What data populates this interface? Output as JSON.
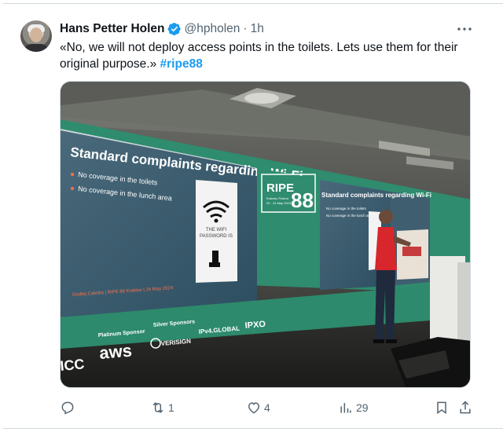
{
  "tweet": {
    "author_name": "Hans Petter Holen",
    "handle": "@hpholen",
    "separator": "·",
    "time": "1h",
    "text_main": "«No, we will not deploy access points in the toilets. Lets use them for their original purpose.» ",
    "hashtag": "#ripe88"
  },
  "media": {
    "slide_title": "Standard complaints regarding Wi-Fi",
    "bullet_1": "No coverage in the toilets",
    "bullet_2": "No coverage in the lunch area",
    "sign_text_1": "THE WIFI",
    "sign_text_2": "PASSWORD IS",
    "slide_footer": "Ondřej Caletka | RIPE 88 Kraków | 24 May 2024",
    "event_logo": "RIPE",
    "event_number": "88",
    "event_place": "Kraków, Poland",
    "event_dates": "20 - 24 May 2024",
    "sponsor_platinum": "Platinum Sponsor",
    "sponsor_silver": "Silver Sponsors",
    "sponsor_aws": "aws",
    "sponsor_verisign": "VERISIGN",
    "sponsor_ipv4": "IPv4.GLOBAL",
    "sponsor_ipxo": "IPXO",
    "edge_text": "ICC"
  },
  "actions": {
    "replies": "",
    "retweets": "1",
    "likes": "4",
    "views": "29"
  },
  "colors": {
    "accent": "#1d9bf0",
    "text_secondary": "#536471",
    "stage_green": "#2f8c6e"
  },
  "icons": [
    "verified-badge-icon",
    "more-icon",
    "reply-icon",
    "retweet-icon",
    "like-icon",
    "views-icon",
    "bookmark-icon",
    "share-icon"
  ]
}
